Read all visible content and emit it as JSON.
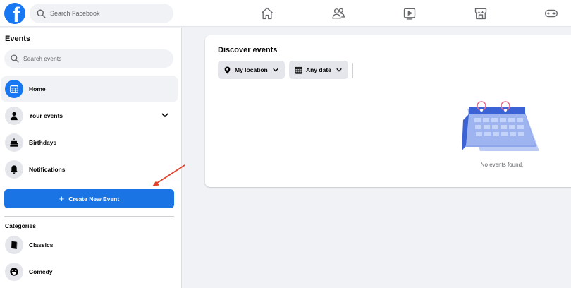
{
  "topbar": {
    "logo_letter": "f",
    "search_placeholder": "Search Facebook",
    "nav_icons": [
      "home-icon",
      "friends-icon",
      "watch-icon",
      "marketplace-icon",
      "gaming-icon"
    ]
  },
  "sidebar": {
    "title": "Events",
    "search_placeholder": "Search events",
    "items": [
      {
        "label": "Home",
        "icon": "calendar-grid-icon",
        "active": true
      },
      {
        "label": "Your events",
        "icon": "person-icon",
        "expandable": true
      },
      {
        "label": "Birthdays",
        "icon": "cake-icon"
      },
      {
        "label": "Notifications",
        "icon": "bell-icon"
      }
    ],
    "create_button": "Create New Event",
    "categories_title": "Categories",
    "categories": [
      {
        "label": "Classics",
        "icon": "book-icon"
      },
      {
        "label": "Comedy",
        "icon": "laughing-face-icon"
      }
    ]
  },
  "main": {
    "title": "Discover events",
    "filters": [
      {
        "label": "My location",
        "icon": "location-pin-icon"
      },
      {
        "label": "Any date",
        "icon": "calendar-icon"
      }
    ],
    "empty_message": "No events found."
  },
  "colors": {
    "brand_blue": "#1877f2",
    "button_blue": "#1b74e4",
    "annotation_arrow": "#e0442e"
  }
}
